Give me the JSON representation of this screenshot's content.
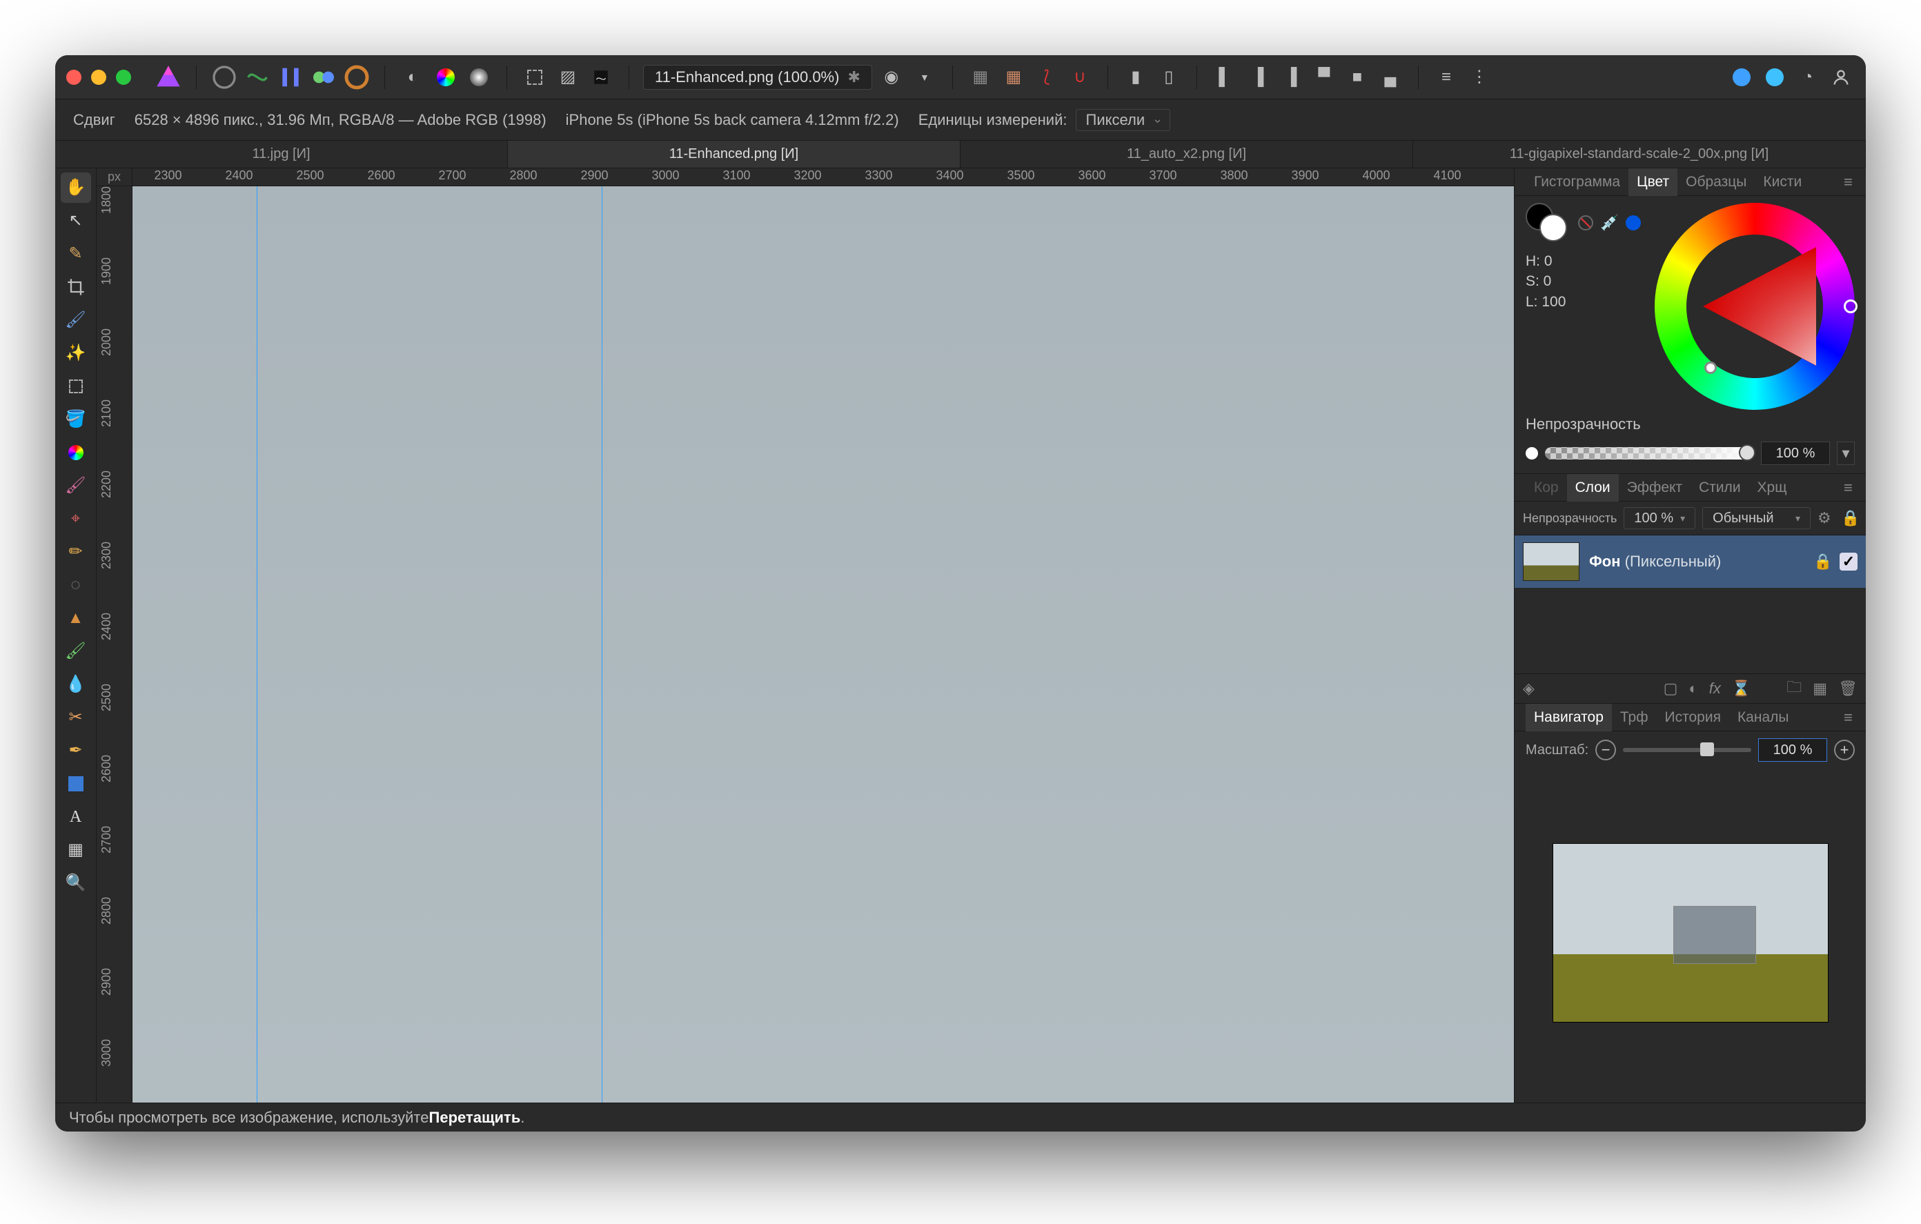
{
  "titlebar": {
    "document_title": "11-Enhanced.png (100.0%)",
    "modified_marker": "✱"
  },
  "context": {
    "tool_label": "Сдвиг",
    "image_spec": "6528 × 4896 пикс., 31.96 Мп, RGBA/8 — Adobe RGB (1998)",
    "camera": "iPhone 5s (iPhone 5s back camera 4.12mm f/2.2)",
    "units_label": "Единицы измерений:",
    "units_value": "Пиксели"
  },
  "doc_tabs": [
    {
      "label": "11.jpg [И]",
      "active": false
    },
    {
      "label": "11-Enhanced.png [И]",
      "active": true
    },
    {
      "label": "11_auto_x2.png [И]",
      "active": false
    },
    {
      "label": "11-gigapixel-standard-scale-2_00x.png [И]",
      "active": false
    }
  ],
  "ruler": {
    "unit_label": "px",
    "h_ticks": [
      "2300",
      "2400",
      "2500",
      "2600",
      "2700",
      "2800",
      "2900",
      "3000",
      "3100",
      "3200",
      "3300",
      "3400",
      "3500",
      "3600",
      "3700",
      "3800",
      "3900",
      "4000",
      "4100"
    ],
    "v_ticks": [
      "1800",
      "1900",
      "2000",
      "2100",
      "2200",
      "2300",
      "2400",
      "2500",
      "2600",
      "2700",
      "2800",
      "2900",
      "3000"
    ]
  },
  "right_tabs_row1": {
    "items": [
      "Гистограмма",
      "Цвет",
      "Образцы",
      "Кисти"
    ],
    "active": 1
  },
  "color_panel": {
    "hsl": {
      "H": "H: 0",
      "S": "S: 0",
      "L": "L: 100"
    },
    "opacity_label": "Непрозрачность",
    "opacity_value": "100 %"
  },
  "right_tabs_row2": {
    "items": [
      "Кор",
      "Слои",
      "Эффект",
      "Стили",
      "Хрщ"
    ],
    "active": 1
  },
  "layers": {
    "opacity_label": "Непрозрачность",
    "opacity_value": "100 %",
    "blend_mode": "Обычный",
    "items": [
      {
        "name": "Фон",
        "type": "(Пиксельный)",
        "locked": true,
        "visible": true
      }
    ]
  },
  "right_tabs_row3": {
    "items": [
      "Навигатор",
      "Трф",
      "История",
      "Каналы"
    ],
    "active": 0
  },
  "navigator": {
    "zoom_label": "Масштаб:",
    "zoom_value": "100 %"
  },
  "statusbar": {
    "prefix": "Чтобы просмотреть все изображение, используйте ",
    "bold": "Перетащить",
    "suffix": "."
  },
  "tools": [
    "view-hand",
    "move-arrow",
    "flood-select",
    "crop",
    "paint-brush",
    "wand",
    "marquee",
    "fill",
    "color-picker",
    "paint",
    "clone",
    "pencil",
    "zoom-blur",
    "inpaint",
    "retouch",
    "smudge",
    "dodge",
    "heal",
    "pen",
    "shape-rect",
    "text",
    "mesh",
    "zoom"
  ]
}
